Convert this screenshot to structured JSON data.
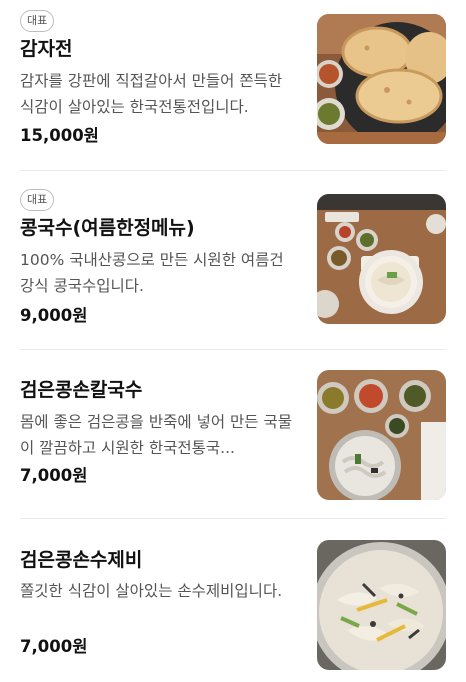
{
  "menu": {
    "items": [
      {
        "badge": "대표",
        "name": "감자전",
        "description": "감자를 강판에 직접갈아서 만들어 쫀득한 식감이 살아있는 한국전통전입니다.",
        "price": "15,000원",
        "image_icon": "potato-pancake-photo"
      },
      {
        "badge": "대표",
        "name": "콩국수(여름한정메뉴)",
        "description": "100% 국내산콩으로 만든 시원한 여름건강식 콩국수입니다.",
        "price": "9,000원",
        "image_icon": "soybean-noodle-photo"
      },
      {
        "name": "검은콩손칼국수",
        "description": "몸에 좋은 검은콩을 반죽에 넣어 만든 국물이 깔끔하고 시원한 한국전통국...",
        "price": "7,000원",
        "image_icon": "black-bean-kalguksu-photo"
      },
      {
        "name": "검은콩손수제비",
        "description": "쫄깃한 식감이 살아있는 손수제비입니다.",
        "price": "7,000원",
        "image_icon": "black-bean-sujebi-photo"
      }
    ]
  }
}
